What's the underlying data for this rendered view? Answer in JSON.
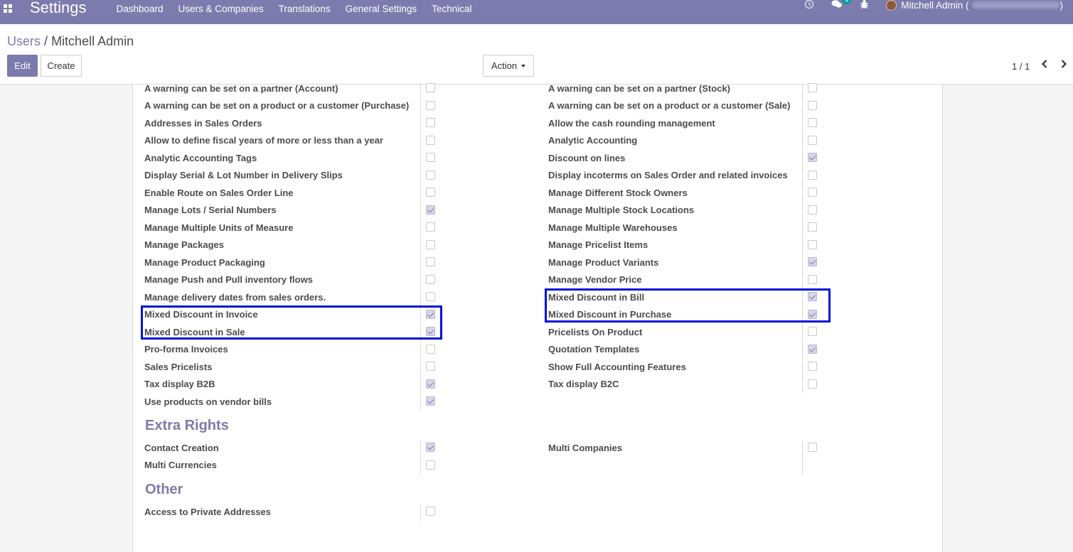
{
  "navbar": {
    "app_title": "Settings",
    "menu": [
      "Dashboard",
      "Users & Companies",
      "Translations",
      "General Settings",
      "Technical"
    ],
    "messages_badge": "1",
    "user_name": "Mitchell Admin (",
    "user_name_close": ")"
  },
  "breadcrumb": {
    "parent": "Users",
    "separator": "/",
    "current": "Mitchell Admin"
  },
  "buttons": {
    "edit": "Edit",
    "create": "Create",
    "action": "Action"
  },
  "pager": {
    "value": "1 / 1"
  },
  "rights": {
    "left": [
      {
        "label": "A warning can be set on a partner (Account)",
        "checked": false
      },
      {
        "label": "A warning can be set on a product or a customer (Purchase)",
        "checked": false
      },
      {
        "label": "Addresses in Sales Orders",
        "checked": false
      },
      {
        "label": "Allow to define fiscal years of more or less than a year",
        "checked": false
      },
      {
        "label": "Analytic Accounting Tags",
        "checked": false
      },
      {
        "label": "Display Serial & Lot Number in Delivery Slips",
        "checked": false
      },
      {
        "label": "Enable Route on Sales Order Line",
        "checked": false
      },
      {
        "label": "Manage Lots / Serial Numbers",
        "checked": true
      },
      {
        "label": "Manage Multiple Units of Measure",
        "checked": false
      },
      {
        "label": "Manage Packages",
        "checked": false
      },
      {
        "label": "Manage Product Packaging",
        "checked": false
      },
      {
        "label": "Manage Push and Pull inventory flows",
        "checked": false
      },
      {
        "label": "Manage delivery dates from sales orders.",
        "checked": false
      },
      {
        "label": "Mixed Discount in Invoice",
        "checked": true
      },
      {
        "label": "Mixed Discount in Sale",
        "checked": true
      },
      {
        "label": "Pro-forma Invoices",
        "checked": false
      },
      {
        "label": "Sales Pricelists",
        "checked": false
      },
      {
        "label": "Tax display B2B",
        "checked": true
      },
      {
        "label": "Use products on vendor bills",
        "checked": true
      }
    ],
    "right": [
      {
        "label": "A warning can be set on a partner (Stock)",
        "checked": false
      },
      {
        "label": "A warning can be set on a product or a customer (Sale)",
        "checked": false
      },
      {
        "label": "Allow the cash rounding management",
        "checked": false
      },
      {
        "label": "Analytic Accounting",
        "checked": false
      },
      {
        "label": "Discount on lines",
        "checked": true
      },
      {
        "label": "Display incoterms on Sales Order and related invoices",
        "checked": false
      },
      {
        "label": "Manage Different Stock Owners",
        "checked": false
      },
      {
        "label": "Manage Multiple Stock Locations",
        "checked": false
      },
      {
        "label": "Manage Multiple Warehouses",
        "checked": false
      },
      {
        "label": "Manage Pricelist Items",
        "checked": false
      },
      {
        "label": "Manage Product Variants",
        "checked": true
      },
      {
        "label": "Manage Vendor Price",
        "checked": false
      },
      {
        "label": "Mixed Discount in Bill",
        "checked": true
      },
      {
        "label": "Mixed Discount in Purchase",
        "checked": true
      },
      {
        "label": "Pricelists On Product",
        "checked": false
      },
      {
        "label": "Quotation Templates",
        "checked": true
      },
      {
        "label": "Show Full Accounting Features",
        "checked": false
      },
      {
        "label": "Tax display B2C",
        "checked": false
      }
    ]
  },
  "extra_rights": {
    "title": "Extra Rights",
    "left": [
      {
        "label": "Contact Creation",
        "checked": true
      },
      {
        "label": "Multi Currencies",
        "checked": false
      }
    ],
    "right": [
      {
        "label": "Multi Companies",
        "checked": false
      }
    ]
  },
  "other": {
    "title": "Other",
    "left": [
      {
        "label": "Access to Private Addresses",
        "checked": false
      }
    ]
  },
  "colors": {
    "brand": "#7c7bad",
    "highlight": "#0010dd"
  }
}
